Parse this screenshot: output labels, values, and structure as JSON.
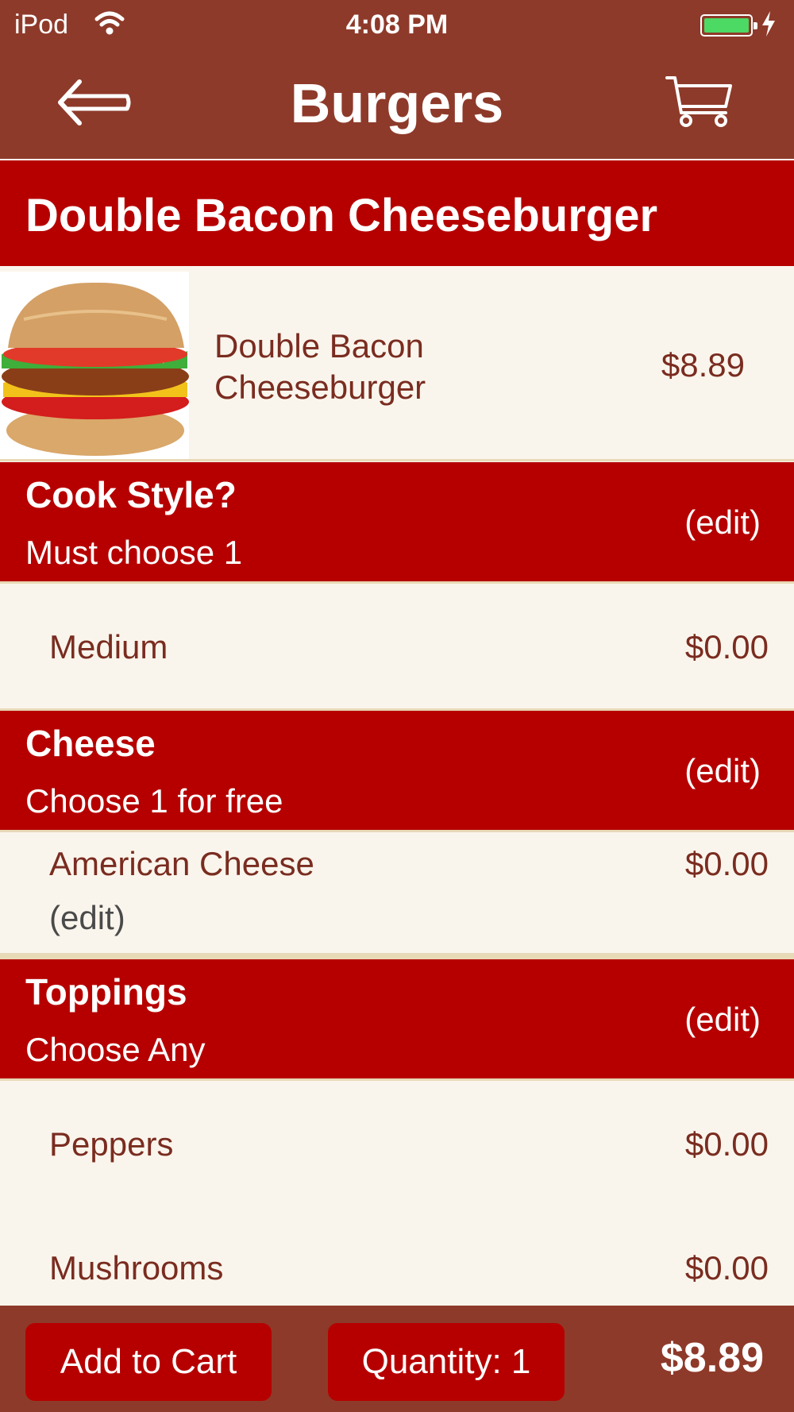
{
  "status_bar": {
    "carrier": "iPod",
    "time": "4:08 PM",
    "battery_color": "#4cd964"
  },
  "nav": {
    "title": "Burgers",
    "back_icon": "back-arrow-icon",
    "cart_icon": "shopping-cart-icon"
  },
  "item": {
    "header_title": "Double Bacon Cheeseburger",
    "name_line1": "Double Bacon",
    "name_line2": "Cheeseburger",
    "price": "$8.89",
    "image_icon": "burger-image"
  },
  "sections": [
    {
      "title": "Cook Style?",
      "subtitle": "Must choose 1",
      "edit_label": "(edit)",
      "options": [
        {
          "label": "Medium",
          "price": "$0.00"
        }
      ]
    },
    {
      "title": "Cheese",
      "subtitle": "Choose 1 for free",
      "edit_label": "(edit)",
      "options": [
        {
          "label": "American Cheese",
          "price": "$0.00",
          "edit_label": "(edit)"
        }
      ]
    },
    {
      "title": "Toppings",
      "subtitle": "Choose Any",
      "edit_label": "(edit)",
      "options": [
        {
          "label": "Peppers",
          "price": "$0.00"
        },
        {
          "label": "Mushrooms",
          "price": "$0.00"
        }
      ]
    }
  ],
  "footer": {
    "add_to_cart_label": "Add to Cart",
    "quantity_label": "Quantity: 1",
    "total": "$8.89"
  },
  "colors": {
    "bar_brown": "#8e3a2a",
    "accent_red": "#b60000",
    "background_cream": "#faf5ec",
    "text_brown": "#7a2c20"
  }
}
